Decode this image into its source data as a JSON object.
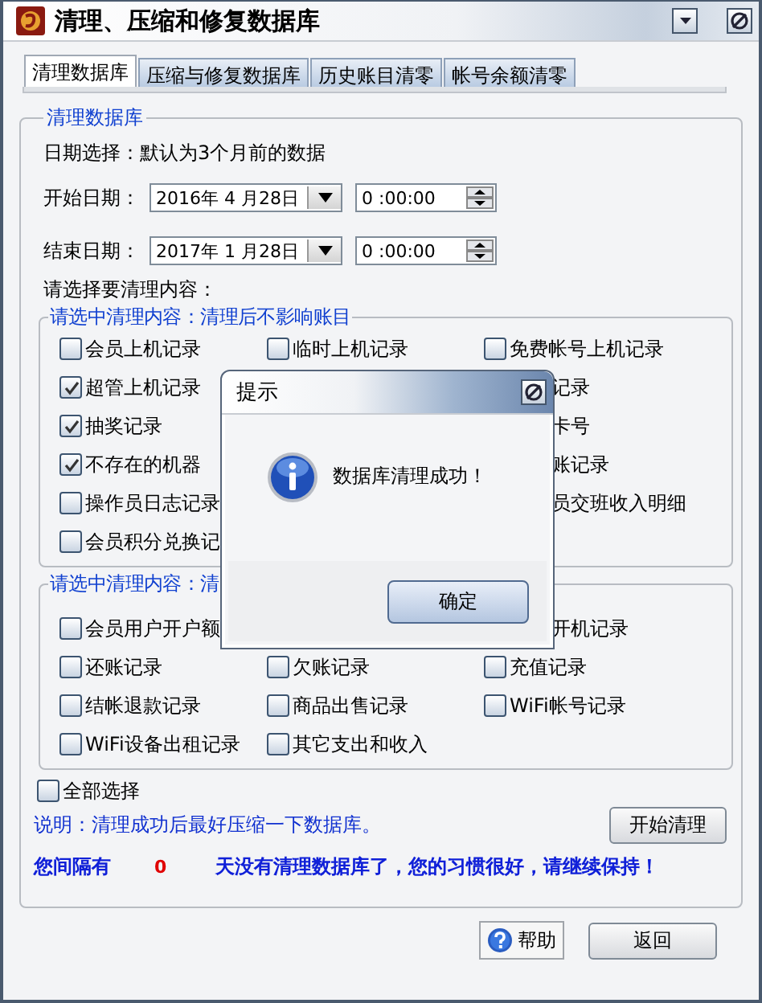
{
  "window": {
    "title": "清理、压缩和修复数据库"
  },
  "tabs": [
    {
      "label": "清理数据库",
      "selected": true
    },
    {
      "label": "压缩与修复数据库",
      "selected": false
    },
    {
      "label": "历史账目清零",
      "selected": false
    },
    {
      "label": "帐号余额清零",
      "selected": false
    }
  ],
  "group": {
    "title": "清理数据库",
    "date_hint": "日期选择：默认为3个月前的数据",
    "dates": [
      {
        "label": "开始日期：",
        "date": "2016年 4 月28日",
        "time": "0 :00:00"
      },
      {
        "label": "结束日期：",
        "date": "2017年 1 月28日",
        "time": "0 :00:00"
      }
    ],
    "content_prompt": "请选择要清理内容：",
    "sections": [
      {
        "title": "请选中清理内容：清理后不影响账目",
        "rows": [
          [
            {
              "kind": "checkbox",
              "label": "会员上机记录",
              "checked": false
            },
            {
              "kind": "checkbox",
              "label": "临时上机记录",
              "checked": false
            },
            {
              "kind": "checkbox",
              "label": "免费帐号上机记录",
              "checked": false
            }
          ],
          [
            {
              "kind": "checkbox",
              "label": "超管上机记录",
              "checked": true
            },
            null,
            {
              "kind": "cut",
              "label": "记录"
            }
          ],
          [
            {
              "kind": "checkbox",
              "label": "抽奖记录",
              "checked": true
            },
            null,
            {
              "kind": "cut",
              "label": "卡号"
            }
          ],
          [
            {
              "kind": "checkbox",
              "label": "不存在的机器",
              "checked": true
            },
            null,
            {
              "kind": "cut",
              "label": "账记录"
            }
          ],
          [
            {
              "kind": "checkbox",
              "label": "操作员日志记录",
              "checked": false
            },
            null,
            {
              "kind": "cut",
              "label": "员交班收入明细"
            }
          ],
          [
            {
              "kind": "checkbox",
              "label": "会员积分兑换记",
              "checked": false
            },
            null,
            null
          ]
        ]
      },
      {
        "title": "请选中清理内容：清",
        "rows": [
          [
            {
              "kind": "checkbox",
              "label": "会员用户开户额",
              "checked": false
            },
            null,
            {
              "kind": "cut",
              "label": "开机记录"
            }
          ],
          [
            {
              "kind": "checkbox",
              "label": "还账记录",
              "checked": false
            },
            {
              "kind": "checkbox",
              "label": "欠账记录",
              "checked": false
            },
            {
              "kind": "checkbox",
              "label": "充值记录",
              "checked": false
            }
          ],
          [
            {
              "kind": "checkbox",
              "label": "结帐退款记录",
              "checked": false
            },
            {
              "kind": "checkbox",
              "label": "商品出售记录",
              "checked": false
            },
            {
              "kind": "checkbox",
              "label": "WiFi帐号记录",
              "checked": false
            }
          ],
          [
            {
              "kind": "checkbox",
              "label": "WiFi设备出租记录",
              "checked": false
            },
            {
              "kind": "checkbox",
              "label": "其它支出和收入",
              "checked": false
            },
            null
          ]
        ]
      }
    ],
    "select_all": {
      "label": "全部选择",
      "checked": false
    },
    "note": "说明：清理成功后最好压缩一下数据库。",
    "start_button": "开始清理",
    "status": {
      "prefix": "您间隔有",
      "days": "0",
      "suffix": "天没有清理数据库了，您的习惯很好，请继续保持！"
    }
  },
  "buttons": {
    "help": "帮助",
    "back": "返回"
  },
  "dialog": {
    "title": "提示",
    "message": "数据库清理成功！",
    "ok": "确定"
  }
}
